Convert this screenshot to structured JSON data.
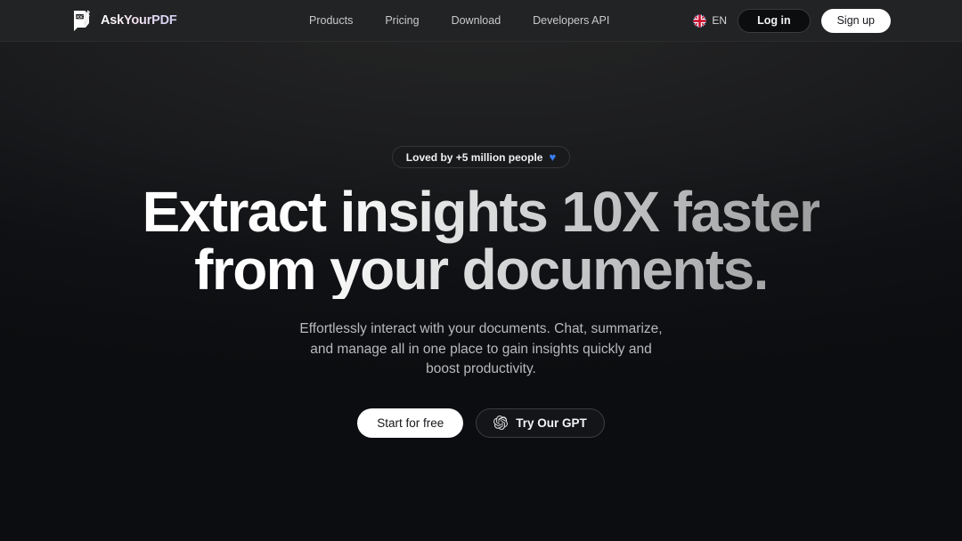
{
  "header": {
    "brand": {
      "name": "AskYourPDF",
      "mark_label": "PDF",
      "icon": "askyourpdf-logo-icon"
    },
    "nav": [
      {
        "label": "Products"
      },
      {
        "label": "Pricing"
      },
      {
        "label": "Download"
      },
      {
        "label": "Developers API"
      }
    ],
    "language": {
      "code": "EN",
      "icon": "uk-flag-icon"
    },
    "login_label": "Log in",
    "signup_label": "Sign up"
  },
  "hero": {
    "badge": {
      "text": "Loved by +5 million people",
      "icon": "blue-heart-icon",
      "glyph": "♥"
    },
    "headline": "Extract insights 10X faster\nfrom your documents.",
    "subtitle": "Effortlessly interact with your documents. Chat, summarize,\nand manage all in one place to gain insights quickly and\nboost productivity.",
    "cta_primary": "Start for free",
    "cta_secondary": {
      "label": "Try Our GPT",
      "icon": "openai-logo-icon"
    }
  },
  "colors": {
    "page_background": "#0b0d10",
    "header_background": "#222324",
    "accent_blue": "#3b7ff5",
    "button_light": "#ffffff",
    "text_primary": "#f2f3f4",
    "text_muted": "#b9babb"
  }
}
